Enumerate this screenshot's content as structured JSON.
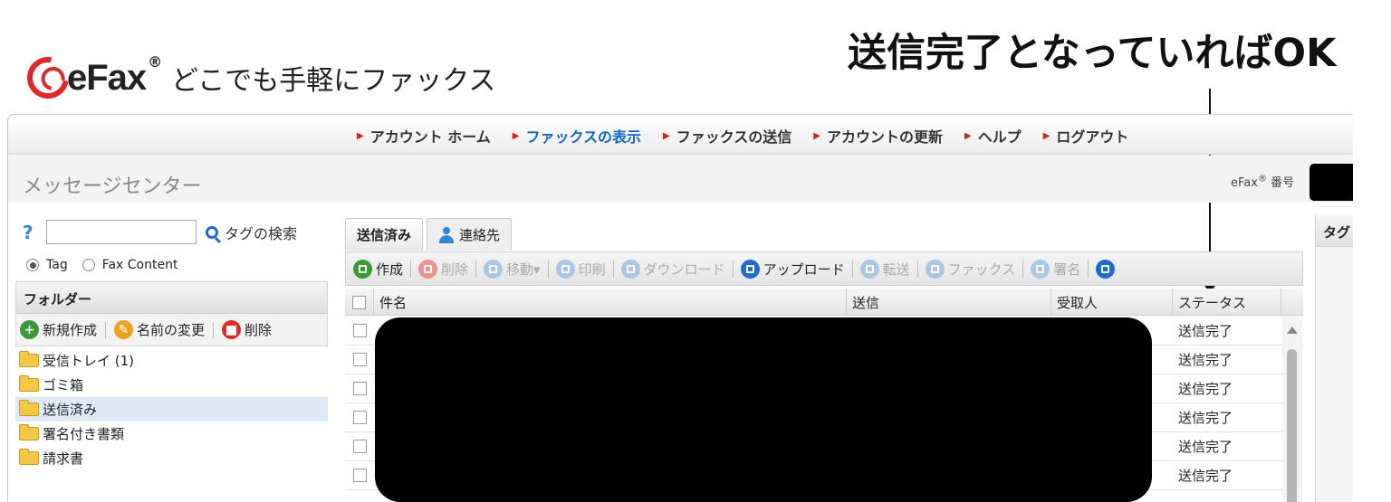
{
  "logo": {
    "brand": "eFax",
    "reg": "®",
    "tagline": "どこでも手軽にファックス"
  },
  "annotation": "送信完了となっていればOK",
  "nav": [
    {
      "label": "アカウント ホーム",
      "active": false
    },
    {
      "label": "ファックスの表示",
      "active": true
    },
    {
      "label": "ファックスの送信",
      "active": false
    },
    {
      "label": "アカウントの更新",
      "active": false
    },
    {
      "label": "ヘルプ",
      "active": false
    },
    {
      "label": "ログアウト",
      "active": false
    }
  ],
  "header": {
    "message_center": "メッセージセンター",
    "efax_number_label": "eFax",
    "efax_number_reg": "®",
    "efax_number_suffix": " 番号"
  },
  "search": {
    "help": "?",
    "value": "",
    "button_label": "タグの検索"
  },
  "search_mode": {
    "tag_label": "Tag",
    "fax_content_label": "Fax Content",
    "selected": "Tag"
  },
  "folders": {
    "heading": "フォルダー",
    "tools": {
      "new_label": "新規作成",
      "rename_label": "名前の変更",
      "delete_label": "削除"
    },
    "items": [
      {
        "label": "受信トレイ (1)",
        "selected": false
      },
      {
        "label": "ゴミ箱",
        "selected": false
      },
      {
        "label": "送信済み",
        "selected": true
      },
      {
        "label": "署名付き書類",
        "selected": false
      },
      {
        "label": "請求書",
        "selected": false
      }
    ]
  },
  "tabs": {
    "sent": "送信済み",
    "contacts": "連絡先"
  },
  "toolbar": {
    "compose": "作成",
    "delete": "削除",
    "move": "移動▾",
    "print": "印刷",
    "download": "ダウンロード",
    "upload": "アップロード",
    "forward": "転送",
    "fax": "ファックス",
    "sign": "署名"
  },
  "grid": {
    "columns": {
      "subject": "件名",
      "sent": "送信",
      "recipient": "受取人",
      "status": "ステータス"
    },
    "rows": [
      {
        "status": "送信完了"
      },
      {
        "status": "送信完了"
      },
      {
        "status": "送信完了"
      },
      {
        "status": "送信完了"
      },
      {
        "status": "送信完了"
      },
      {
        "status": "送信完了"
      }
    ]
  },
  "right_panel": {
    "heading": "タグ"
  },
  "colors": {
    "accent_red": "#e3262a",
    "link_blue": "#1166cc",
    "selected_row": "#dfe9f7"
  }
}
